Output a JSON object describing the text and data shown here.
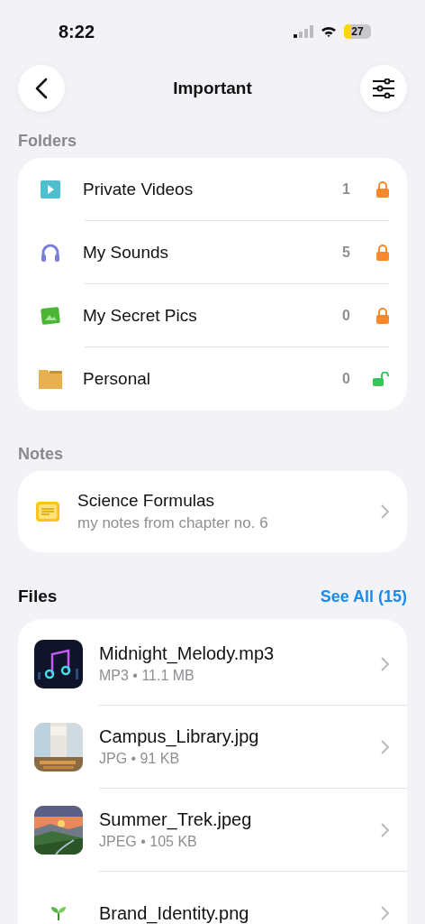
{
  "status_bar": {
    "time": "8:22",
    "battery": {
      "level": 0.27,
      "reading": "27"
    }
  },
  "nav": {
    "title": "Important"
  },
  "folders": {
    "heading": "Folders",
    "items": [
      {
        "kind": "video",
        "name": "Private Videos",
        "count": "1",
        "locked": true
      },
      {
        "kind": "sound",
        "name": "My Sounds",
        "count": "5",
        "locked": true
      },
      {
        "kind": "pics",
        "name": "My Secret Pics",
        "count": "0",
        "locked": true
      },
      {
        "kind": "folder",
        "name": "Personal",
        "count": "0",
        "locked": false
      }
    ]
  },
  "notes": {
    "heading": "Notes",
    "items": [
      {
        "title": "Science Formulas",
        "subtitle": "my notes from chapter no. 6"
      }
    ]
  },
  "files": {
    "heading": "Files",
    "see_all": "See All (15)",
    "items": [
      {
        "kind": "music",
        "name": "Midnight_Melody.mp3",
        "meta": "MP3 • 11.1 MB"
      },
      {
        "kind": "interior",
        "name": "Campus_Library.jpg",
        "meta": "JPG • 91 KB"
      },
      {
        "kind": "landscape",
        "name": "Summer_Trek.jpeg",
        "meta": "JPEG • 105 KB"
      },
      {
        "kind": "logo",
        "name": "Brand_Identity.png"
      }
    ]
  }
}
